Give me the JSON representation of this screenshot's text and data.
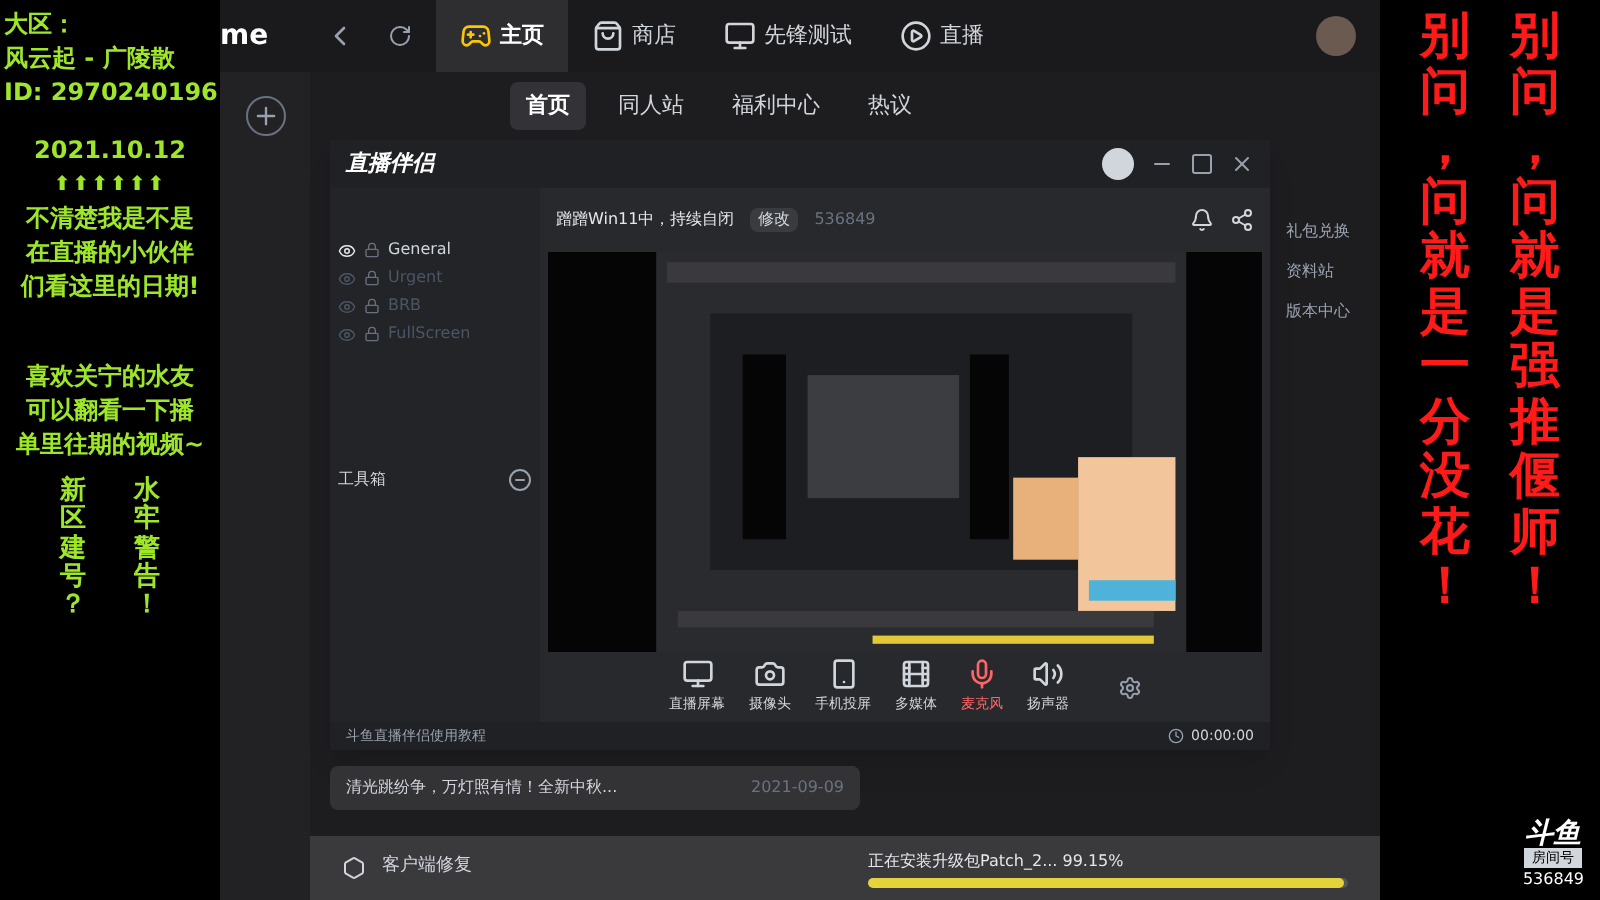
{
  "left_overlay": {
    "lines": [
      "大区：",
      "风云起 - 广陵散",
      "ID: 2970240196"
    ],
    "date": "2021.10.12",
    "arrows": "⬆⬆⬆⬆⬆⬆",
    "note": [
      "不清楚我是不是",
      "在直播的小伙伴",
      "们看这里的日期!"
    ],
    "note2": [
      "喜欢关宁的水友",
      "可以翻看一下播",
      "单里往期的视频~"
    ],
    "columns": [
      "新区建号？",
      "水牢警告！"
    ]
  },
  "right_overlay": {
    "columns": [
      "别问，问就是一分没花！",
      "别问，问就是强推偃师！"
    ],
    "logo": "斗鱼",
    "room_label": "房间号",
    "room_id": "536849"
  },
  "launcher": {
    "brand": "me",
    "tabs": [
      {
        "label": "主页",
        "selected": true
      },
      {
        "label": "商店",
        "selected": false
      },
      {
        "label": "先锋测试",
        "selected": false
      },
      {
        "label": "直播",
        "selected": false
      }
    ],
    "subnav": [
      {
        "label": "首页",
        "selected": true
      },
      {
        "label": "同人站",
        "selected": false
      },
      {
        "label": "福利中心",
        "selected": false
      },
      {
        "label": "热议",
        "selected": false
      }
    ],
    "side_links": [
      "礼包兑换",
      "资料站",
      "版本中心"
    ],
    "news": [
      {
        "title": "清光跳纷争，万灯照有情！全新中秋...",
        "date": "2021-09-09"
      }
    ],
    "repair": "客户端修复",
    "progress": {
      "text": "正在安装升级包Patch_2... 99.15%",
      "level": 0.9915
    }
  },
  "streamer": {
    "app_name": "直播伴侣",
    "scenes": [
      {
        "name": "General",
        "visible": true
      },
      {
        "name": "Urgent",
        "visible": false
      },
      {
        "name": "BRB",
        "visible": false
      },
      {
        "name": "FullScreen",
        "visible": false
      }
    ],
    "title": "蹭蹭Win11中，持续自闭",
    "edit": "修改",
    "room_id": "536849",
    "toolbox": "工具箱",
    "toolbar": [
      "直播屏幕",
      "摄像头",
      "手机投屏",
      "多媒体",
      "麦克风",
      "扬声器"
    ],
    "tutorial": "斗鱼直播伴侣使用教程",
    "timer": "00:00:00"
  }
}
